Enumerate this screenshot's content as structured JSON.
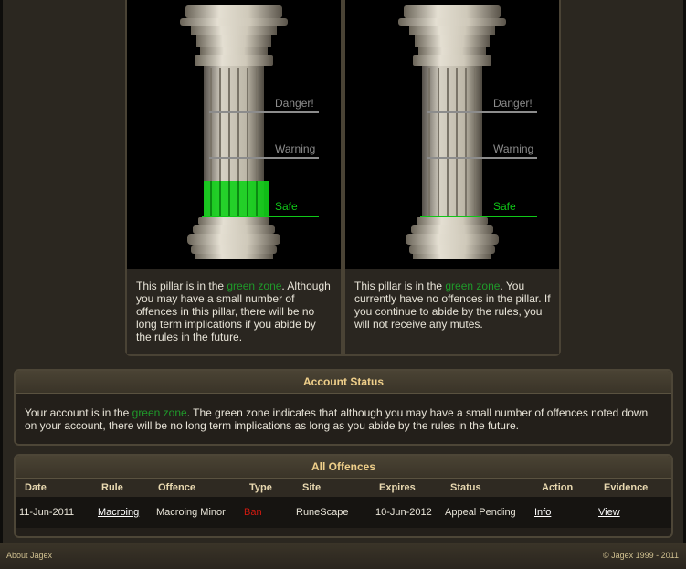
{
  "pillars": [
    {
      "labels": {
        "danger": "Danger!",
        "warning": "Warning",
        "safe": "Safe"
      },
      "fill_level": "safe",
      "desc_prefix": "This pillar is in the ",
      "desc_zone": "green zone",
      "desc_suffix": ". Although you may have a small number of offences in this pillar, there will be no long term implications if you abide by the rules in the future."
    },
    {
      "labels": {
        "danger": "Danger!",
        "warning": "Warning",
        "safe": "Safe"
      },
      "fill_level": "none",
      "desc_prefix": "This pillar is in the ",
      "desc_zone": "green zone",
      "desc_suffix": ". You currently have no offences in the pillar. If you continue to abide by the rules, you will not receive any mutes."
    }
  ],
  "account_status": {
    "title": "Account Status",
    "text_prefix": "Your account is in the ",
    "text_zone": "green zone",
    "text_suffix": ". The green zone indicates that although you may have a small number of offences noted down on your account, there will be no long term implications as long as you abide by the rules in the future."
  },
  "offences": {
    "title": "All Offences",
    "columns": [
      "Date",
      "Rule",
      "Offence",
      "Type",
      "Site",
      "Expires",
      "Status",
      "Action",
      "Evidence"
    ],
    "rows": [
      {
        "date": "11-Jun-2011",
        "rule": "Macroing",
        "offence": "Macroing Minor",
        "type": "Ban",
        "site": "RuneScape",
        "expires": "10-Jun-2012",
        "status": "Appeal Pending",
        "action": "Info",
        "evidence": "View"
      }
    ]
  },
  "footer": {
    "left": "About Jagex",
    "right": "© Jagex 1999 - 2011"
  },
  "colors": {
    "green_zone": "#1f9a2a",
    "ban": "#d01a10",
    "header_gold": "#efcf8a"
  }
}
